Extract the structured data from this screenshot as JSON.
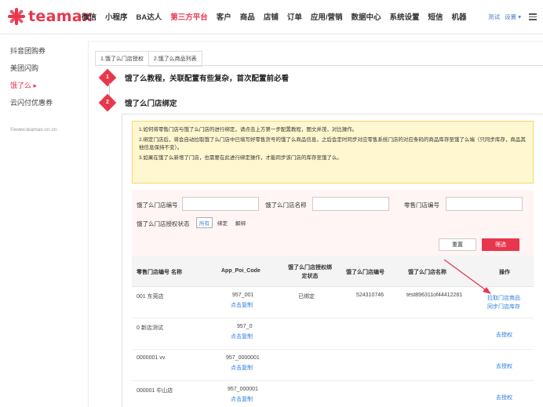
{
  "brand": {
    "logo_text": "teamax",
    "accent": "#e8374d"
  },
  "nav": {
    "items": [
      "微信",
      "小程序",
      "BA达人",
      "第三方平台",
      "客户",
      "商品",
      "店铺",
      "订单",
      "应用/营销",
      "数据中心",
      "系统设置",
      "短信",
      "机器"
    ],
    "active_index": 3,
    "user": "测试",
    "settings": "设置 ▾",
    "menu_icon": "hamburger-icon"
  },
  "sidebar": {
    "items": [
      "抖音团购券",
      "美团闪购",
      "饿了么 ▸",
      "云闪付优惠券"
    ],
    "active_index": 2,
    "copyright": "©www.teamax-cn.cn"
  },
  "tabs": [
    "1.饿了么门店授权",
    "2.饿了么商品列表"
  ],
  "steps": [
    {
      "num": "1",
      "title": "饿了么教程，关联配置有些复杂，首次配置前必看"
    },
    {
      "num": "2",
      "title": "饿了么门店绑定"
    }
  ],
  "notice": [
    "1.如何将零售门店与饿了么门店的进行绑定，请点击上方第一步配置教程，图文并茂，对比操作。",
    "2.绑定门店后，将会自动拉取饿了么门店中已填写好零售货号的饿了么商品信息，之后会定时同步对应零售系统门店的对应条码的商品库存至饿了么端（只同步库存，商品其他信息保持不变）。",
    "3.如果在饿了么新增了门店，也需要在此进行绑定操作，才能同步该门店的库存至饿了么。"
  ],
  "filter": {
    "elm_store_no_label": "饿了么门店编号",
    "elm_store_name_label": "饿了么门店名称",
    "retail_store_no_label": "零售门店编号",
    "auth_status_label": "饿了么门店授权状态",
    "status_options": [
      "所有",
      "绑定",
      "解绑"
    ],
    "selected_status": 0,
    "reset": "重置",
    "submit": "筛选"
  },
  "table": {
    "headers": [
      "零售门店编号 名称",
      "App_Poi_Code",
      "饿了么门店授权绑定状态",
      "饿了么门店编号",
      "饿了么门店名称",
      "操作"
    ],
    "copy_label": "点击复制",
    "rows": [
      {
        "store": "001  东莞店",
        "poi": "957_001",
        "status": "已绑定",
        "elm_no": "524310746",
        "elm_name": "test896311of44412281",
        "actions": [
          "拉取门店商品",
          "同步门店库存"
        ]
      },
      {
        "store": "0  新店测试",
        "poi": "957_0",
        "status": "",
        "elm_no": "",
        "elm_name": "",
        "actions": [
          "去授权"
        ]
      },
      {
        "store": "0000001  vv",
        "poi": "957_0000001",
        "status": "",
        "elm_no": "",
        "elm_name": "",
        "actions": [
          "去授权"
        ]
      },
      {
        "store": "000001  中山店",
        "poi": "957_000001",
        "status": "",
        "elm_no": "",
        "elm_name": "",
        "actions": [
          "去授权"
        ]
      }
    ]
  }
}
